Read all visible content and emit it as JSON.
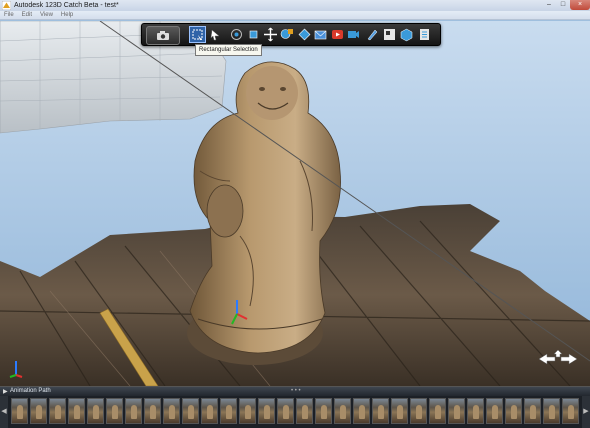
{
  "window": {
    "title": "Autodesk 123D Catch Beta - test*",
    "controls": {
      "minimize": "–",
      "maximize": "□",
      "close": "×"
    }
  },
  "menu": [
    "File",
    "Edit",
    "View",
    "Help"
  ],
  "toolbar": {
    "tooltip": "Rectangular Selection",
    "icons": [
      "camera-icon",
      "rectangular-selection-icon",
      "lasso-selection-icon",
      "orbit-icon",
      "pan-icon",
      "zoom-icon",
      "fit-icon",
      "share-icon",
      "email-icon",
      "youtube-icon",
      "video-icon",
      "edit-icon",
      "export-icon",
      "cube-icon",
      "document-icon"
    ]
  },
  "animation_path": {
    "label": "Animation Path",
    "grip": "• • •",
    "scroll_left": "◀",
    "scroll_right": "▶"
  },
  "filmstrip": {
    "thumbnail_count": 30
  },
  "colors": {
    "sky": "#9fbfde",
    "toolbar": "#1e1e1e",
    "active": "#2f63a8",
    "filmstrip": "#1c2026"
  }
}
